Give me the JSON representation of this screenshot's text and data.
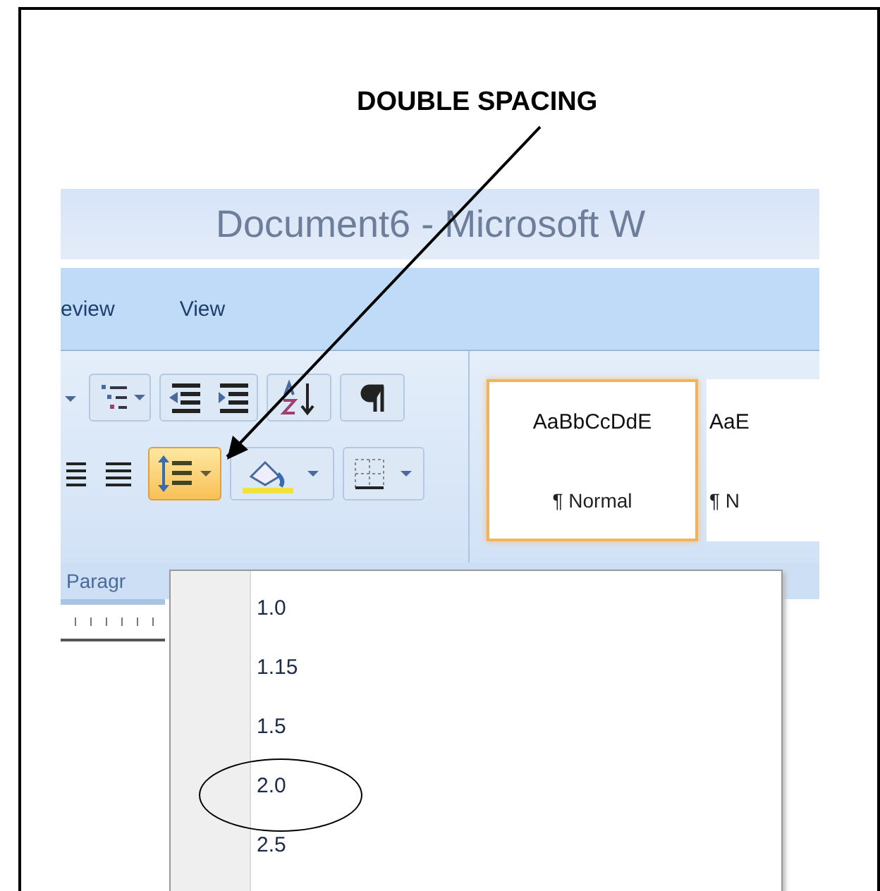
{
  "annotation": {
    "label": "DOUBLE SPACING"
  },
  "window": {
    "title": "Document6 - Microsoft W"
  },
  "tabs": [
    {
      "label": "eview",
      "selected": false
    },
    {
      "label": "View",
      "selected": false
    }
  ],
  "ribbon": {
    "line_spacing_button": {
      "on": true
    },
    "group_label": "Paragr"
  },
  "styles": [
    {
      "preview": "AaBbCcDdE",
      "name": "¶ Normal",
      "selected": true
    },
    {
      "preview": "AaE",
      "name": "¶ N",
      "selected": false
    }
  ],
  "menu": {
    "items": [
      {
        "label": "1.0",
        "circled": false
      },
      {
        "label": "1.15",
        "circled": false
      },
      {
        "label": "1.5",
        "circled": false
      },
      {
        "label": "2.0",
        "circled": true
      },
      {
        "label": "2.5",
        "circled": false
      }
    ]
  }
}
